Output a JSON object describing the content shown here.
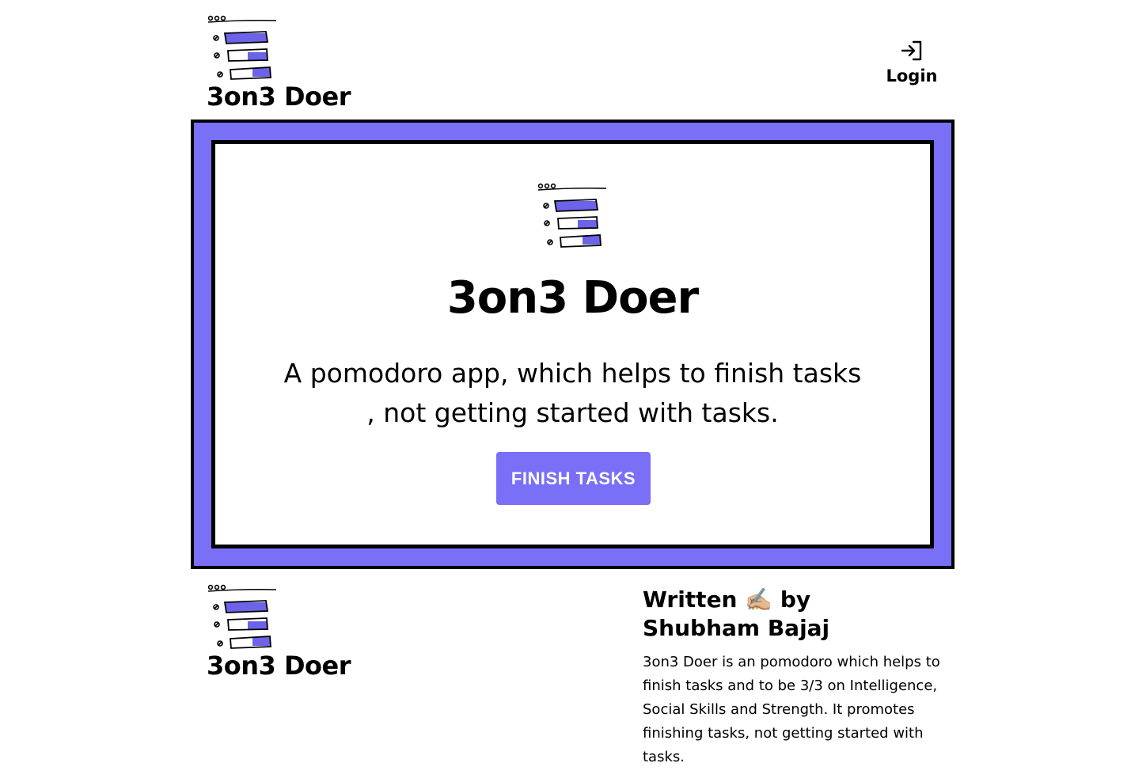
{
  "brand": {
    "name": "3on3 Doer"
  },
  "header": {
    "login_label": "Login"
  },
  "hero": {
    "title": "3on3 Doer",
    "tagline_line1": "A pomodoro app, which helps to finish tasks",
    "tagline_line2": ", not getting started with tasks.",
    "cta_label": "FINISH TASKS"
  },
  "footer": {
    "brand_name": "3on3 Doer",
    "about_title_part1": "Written",
    "about_title_emoji": "✍🏼",
    "about_title_part2": "by",
    "about_author": "Shubham Bajaj",
    "about_text": "3on3 Doer is an pomodoro which helps to finish tasks and to be 3/3 on Intelligence, Social Skills and Strength. It promotes finishing tasks, not getting started with tasks."
  },
  "colors": {
    "accent": "#7a6ff7",
    "text": "#000000",
    "background": "#ffffff"
  },
  "icons": {
    "logo": "checklist-logo-icon",
    "login": "login-arrow-icon"
  }
}
